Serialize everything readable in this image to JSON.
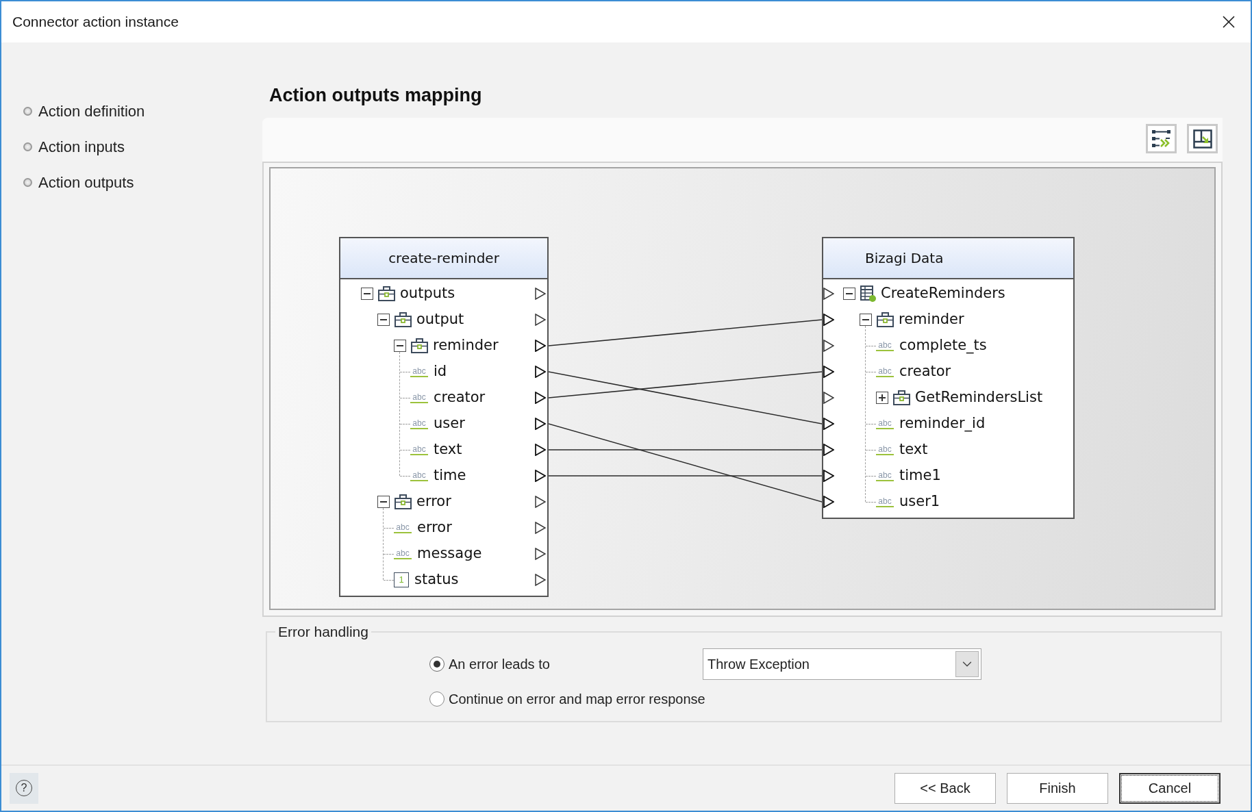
{
  "window": {
    "title": "Connector action instance"
  },
  "sidebar": {
    "items": [
      {
        "label": "Action definition"
      },
      {
        "label": "Action inputs"
      },
      {
        "label": "Action outputs"
      }
    ]
  },
  "heading": "Action outputs mapping",
  "mapping": {
    "source": {
      "title": "create-reminder",
      "nodes": [
        {
          "label": "outputs",
          "kind": "object",
          "expanded": true,
          "linked": false,
          "children": [
            {
              "label": "output",
              "kind": "object",
              "expanded": true,
              "linked": false,
              "children": [
                {
                  "label": "reminder",
                  "kind": "object",
                  "expanded": true,
                  "linked": true,
                  "children": [
                    {
                      "label": "id",
                      "kind": "string",
                      "badge": "abc",
                      "linked": true
                    },
                    {
                      "label": "creator",
                      "kind": "string",
                      "badge": "abc",
                      "linked": true
                    },
                    {
                      "label": "user",
                      "kind": "string",
                      "badge": "abc",
                      "linked": true
                    },
                    {
                      "label": "text",
                      "kind": "string",
                      "badge": "abc",
                      "linked": true
                    },
                    {
                      "label": "time",
                      "kind": "string",
                      "badge": "abc",
                      "linked": true
                    }
                  ]
                }
              ]
            },
            {
              "label": "error",
              "kind": "object",
              "expanded": true,
              "linked": false,
              "children": [
                {
                  "label": "error",
                  "kind": "string",
                  "badge": "abc",
                  "linked": false
                },
                {
                  "label": "message",
                  "kind": "string",
                  "badge": "abc",
                  "linked": false
                },
                {
                  "label": "status",
                  "kind": "number",
                  "badge": "1",
                  "linked": false
                }
              ]
            }
          ]
        }
      ]
    },
    "target": {
      "title": "Bizagi Data",
      "nodes": [
        {
          "label": "CreateReminders",
          "kind": "entity",
          "expanded": true,
          "linked": false,
          "children": [
            {
              "label": "reminder",
              "kind": "object",
              "expanded": true,
              "linked": true,
              "children": [
                {
                  "label": "complete_ts",
                  "kind": "string",
                  "badge": "abc",
                  "linked": false
                },
                {
                  "label": "creator",
                  "kind": "string",
                  "badge": "abc",
                  "linked": true
                },
                {
                  "label": "GetRemindersList",
                  "kind": "object",
                  "expanded": false,
                  "linked": false
                },
                {
                  "label": "reminder_id",
                  "kind": "string",
                  "badge": "abc",
                  "linked": true
                },
                {
                  "label": "text",
                  "kind": "string",
                  "badge": "abc",
                  "linked": true
                },
                {
                  "label": "time1",
                  "kind": "string",
                  "badge": "abc",
                  "linked": true
                },
                {
                  "label": "user1",
                  "kind": "string",
                  "badge": "abc",
                  "linked": true
                }
              ]
            }
          ]
        }
      ]
    }
  },
  "error_handling": {
    "legend": "Error handling",
    "options": [
      {
        "label": "An error leads to",
        "selected": true
      },
      {
        "label": "Continue on error and map error response",
        "selected": false
      }
    ],
    "dropdown": {
      "value": "Throw Exception"
    }
  },
  "footer": {
    "help": "?",
    "buttons": [
      {
        "label": "<< Back",
        "focused": false
      },
      {
        "label": "Finish",
        "focused": false
      },
      {
        "label": "Cancel",
        "focused": true
      }
    ]
  }
}
